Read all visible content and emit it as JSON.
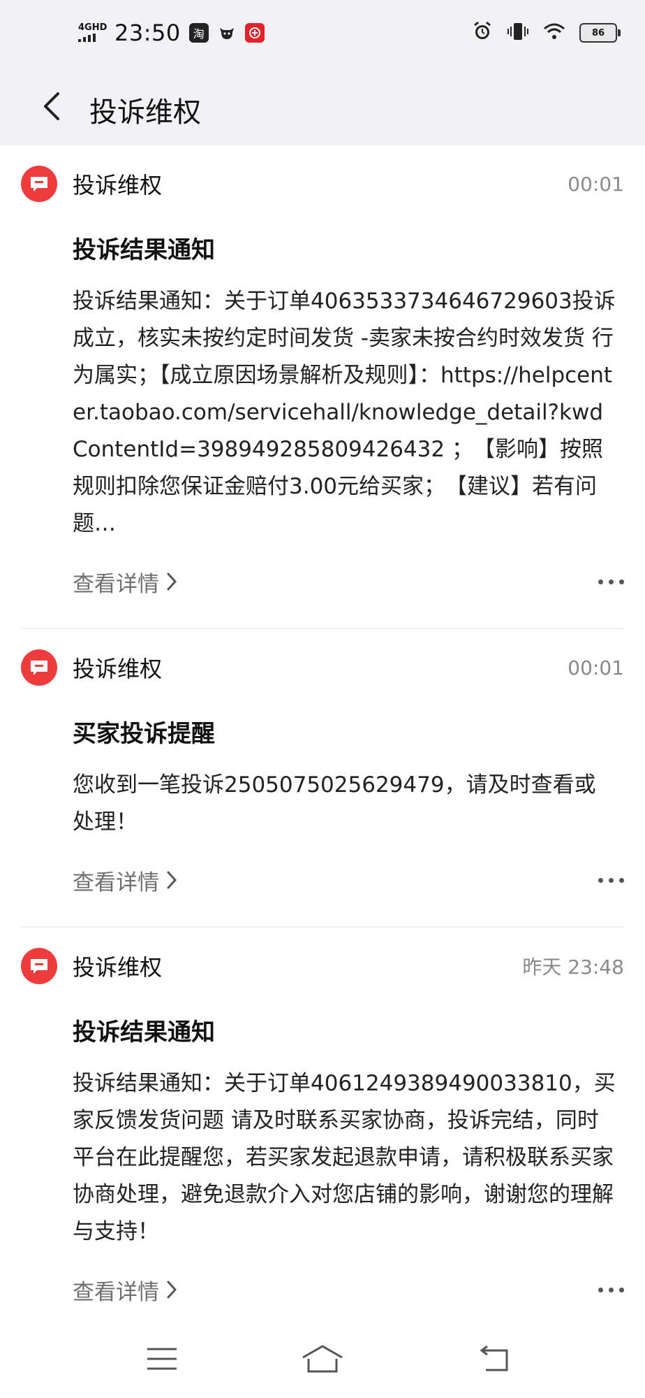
{
  "status_bar": {
    "network": "4GHD",
    "time": "23:50",
    "app_icons": [
      "淘"
    ],
    "battery": "86"
  },
  "header": {
    "title": "投诉维权"
  },
  "messages": [
    {
      "sender": "投诉维权",
      "time": "00:01",
      "title": "投诉结果通知",
      "body": "投诉结果通知：关于订单4063533734646729603投诉成立，核实未按约定时间发货 -卖家未按合约时效发货 行为属实；【成立原因场景解析及规则】：https://helpcenter.taobao.com/servicehall/knowledge_detail?kwdContentId=398949285809426432 ；　【影响】按照规则扣除您保证金赔付3.00元给买家；　【建议】若有问题…",
      "detail_label": "查看详情"
    },
    {
      "sender": "投诉维权",
      "time": "00:01",
      "title": "买家投诉提醒",
      "body": "您收到一笔投诉2505075025629479，请及时查看或处理！",
      "detail_label": "查看详情"
    },
    {
      "sender": "投诉维权",
      "time": "昨天 23:48",
      "title": "投诉结果通知",
      "body": "投诉结果通知：关于订单4061249389490033810，买家反馈发货问题 请及时联系买家协商，投诉完结，同时平台在此提醒您，若买家发起退款申请，请积极联系买家协商处理，避免退款介入对您店铺的影响，谢谢您的理解与支持！",
      "detail_label": "查看详情"
    }
  ],
  "colors": {
    "avatar": "#ee3b3b",
    "header_bg": "#f2f2f5"
  }
}
